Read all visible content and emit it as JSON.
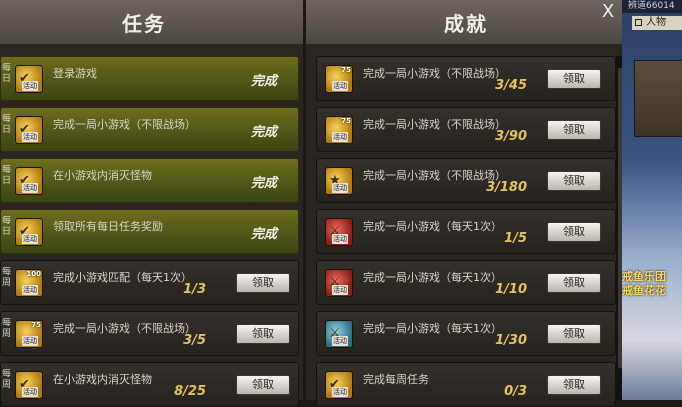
{
  "tasks": {
    "title": "任务",
    "items": [
      {
        "side": "每日",
        "icon_num": "",
        "icon_tag": "活动",
        "title": "登录游戏",
        "status": "完成",
        "done": true
      },
      {
        "side": "每日",
        "icon_num": "",
        "icon_tag": "活动",
        "title": "完成一局小游戏（不限战场）",
        "status": "完成",
        "done": true
      },
      {
        "side": "每日",
        "icon_num": "",
        "icon_tag": "活动",
        "title": "在小游戏内消灭怪物",
        "status": "完成",
        "done": true
      },
      {
        "side": "每日",
        "icon_num": "",
        "icon_tag": "活动",
        "title": "领取所有每日任务奖励",
        "status": "完成",
        "done": true
      },
      {
        "side": "每周",
        "icon_num": "100",
        "icon_tag": "活动",
        "title": "完成小游戏匹配（每天1次）",
        "progress": "1/3",
        "button": "领取",
        "done": false
      },
      {
        "side": "每周",
        "icon_num": "75",
        "icon_tag": "活动",
        "title": "完成一局小游戏（不限战场）",
        "progress": "3/5",
        "button": "领取",
        "done": false
      },
      {
        "side": "每周",
        "icon_num": "",
        "icon_tag": "活动",
        "title": "在小游戏内消灭怪物",
        "progress": "8/25",
        "button": "领取",
        "done": false
      }
    ]
  },
  "achievements": {
    "title": "成就",
    "close_label": "X",
    "items": [
      {
        "icon_num": "75",
        "icon_tag": "活动",
        "title": "完成一局小游戏（不限战场）",
        "progress": "3/45",
        "button": "领取"
      },
      {
        "icon_num": "75",
        "icon_tag": "活动",
        "title": "完成一局小游戏（不限战场）",
        "progress": "3/90",
        "button": "领取"
      },
      {
        "icon_num": "",
        "icon_tag": "活动",
        "title": "完成一局小游戏（不限战场）",
        "progress": "3/180",
        "button": "领取"
      },
      {
        "icon_num": "",
        "icon_tag": "活动",
        "title": "完成一局小游戏（每天1次）",
        "progress": "1/5",
        "button": "领取"
      },
      {
        "icon_num": "",
        "icon_tag": "活动",
        "title": "完成一局小游戏（每天1次）",
        "progress": "1/10",
        "button": "领取"
      },
      {
        "icon_num": "",
        "icon_tag": "活动",
        "title": "完成一局小游戏（每天1次）",
        "progress": "1/30",
        "button": "领取"
      },
      {
        "icon_num": "",
        "icon_tag": "活动",
        "title": "完成每周任务",
        "progress": "0/3",
        "button": "领取"
      }
    ]
  },
  "right_panel": {
    "top_text": "辨道66014",
    "tab_label": "人物",
    "guild_line1": "戒鱼乐团",
    "guild_line2": "戒鱼花花"
  }
}
